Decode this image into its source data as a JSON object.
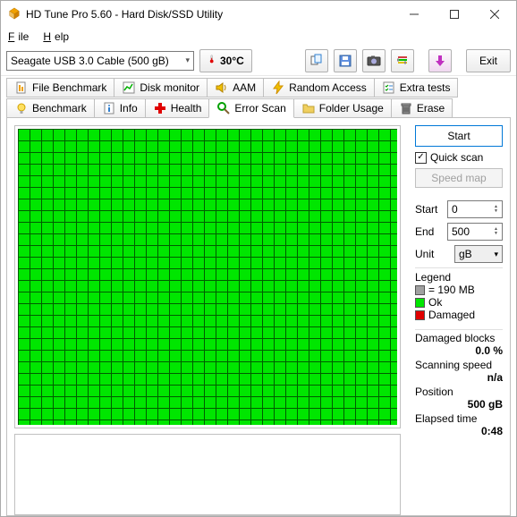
{
  "window": {
    "title": "HD Tune Pro 5.60 - Hard Disk/SSD Utility"
  },
  "menu": {
    "file": "File",
    "help": "Help"
  },
  "toolbar": {
    "device": "Seagate USB 3.0 Cable (500 gB)",
    "temp": "30°C",
    "exit": "Exit"
  },
  "tabs": {
    "row1": {
      "file_benchmark": "File Benchmark",
      "disk_monitor": "Disk monitor",
      "aam": "AAM",
      "random_access": "Random Access",
      "extra_tests": "Extra tests"
    },
    "row2": {
      "benchmark": "Benchmark",
      "info": "Info",
      "health": "Health",
      "error_scan": "Error Scan",
      "folder_usage": "Folder Usage",
      "erase": "Erase"
    }
  },
  "panel": {
    "start_btn": "Start",
    "quick_scan": "Quick scan",
    "speed_map": "Speed map",
    "start_label": "Start",
    "start_val": "0",
    "end_label": "End",
    "end_val": "500",
    "unit_label": "Unit",
    "unit_val": "gB",
    "legend_title": "Legend",
    "block_size": "= 190 MB",
    "ok": "Ok",
    "damaged": "Damaged",
    "damaged_blocks_lbl": "Damaged blocks",
    "damaged_blocks_val": "0.0 %",
    "speed_lbl": "Scanning speed",
    "speed_val": "n/a",
    "pos_lbl": "Position",
    "pos_val": "500 gB",
    "elapsed_lbl": "Elapsed time",
    "elapsed_val": "0:48"
  },
  "colors": {
    "ok": "#00e600",
    "damaged": "#e00000",
    "block": "#a0a0a0"
  }
}
